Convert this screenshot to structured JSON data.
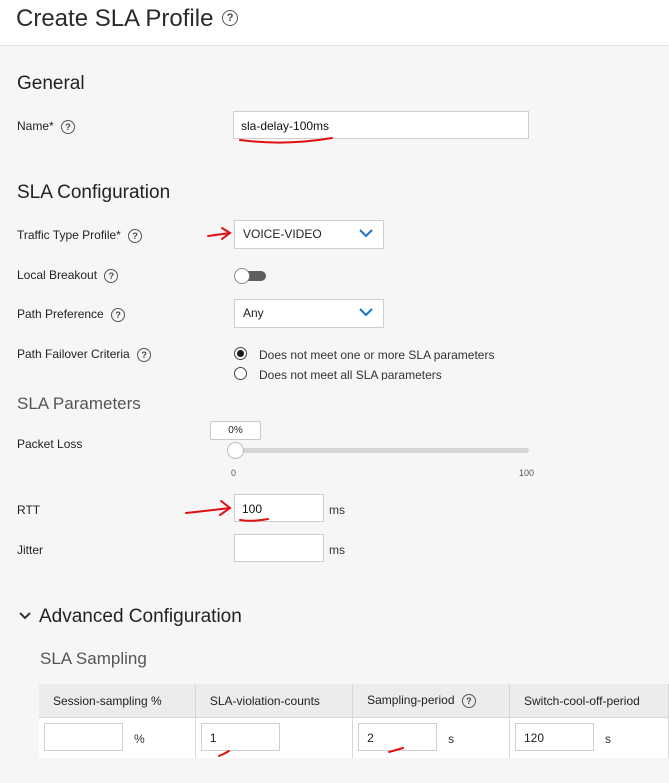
{
  "header": {
    "title": "Create SLA Profile"
  },
  "general": {
    "heading": "General",
    "name_label": "Name*",
    "name_value": "sla-delay-100ms"
  },
  "sla_config": {
    "heading": "SLA Configuration",
    "traffic_type_label": "Traffic Type Profile*",
    "traffic_type_value": "VOICE-VIDEO",
    "local_breakout_label": "Local Breakout",
    "local_breakout_on": false,
    "path_pref_label": "Path Preference",
    "path_pref_value": "Any",
    "failover_label": "Path Failover Criteria",
    "failover_options": [
      {
        "label": "Does not meet one or more SLA parameters",
        "selected": true
      },
      {
        "label": "Does not meet all SLA parameters",
        "selected": false
      }
    ]
  },
  "sla_params": {
    "heading": "SLA Parameters",
    "packet_loss_label": "Packet Loss",
    "packet_loss_value": "0%",
    "packet_loss_level": 0,
    "slider_min": "0",
    "slider_max": "100",
    "rtt_label": "RTT",
    "rtt_value": "100",
    "rtt_unit": "ms",
    "jitter_label": "Jitter",
    "jitter_value": "",
    "jitter_unit": "ms"
  },
  "advanced": {
    "heading": "Advanced Configuration",
    "sampling_heading": "SLA Sampling",
    "columns": [
      "Session-sampling %",
      "SLA-violation-counts",
      "Sampling-period",
      "Switch-cool-off-period"
    ],
    "values": [
      "",
      "1",
      "2",
      "120"
    ],
    "units": [
      "%",
      "",
      "s",
      "s"
    ]
  },
  "colors": {
    "annotation": "#e01010",
    "accent": "#1a73c8"
  }
}
